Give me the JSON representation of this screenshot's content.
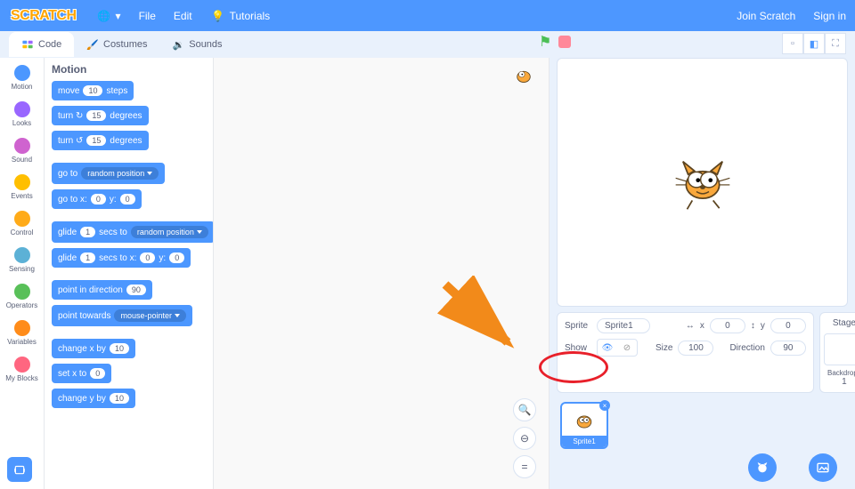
{
  "menubar": {
    "logo": "SCRATCH",
    "globe": "🌐",
    "file": "File",
    "edit": "Edit",
    "tutorials": "Tutorials",
    "join": "Join Scratch",
    "signin": "Sign in"
  },
  "tabs": {
    "code": "Code",
    "costumes": "Costumes",
    "sounds": "Sounds"
  },
  "categories": [
    {
      "name": "Motion",
      "color": "#4c97ff"
    },
    {
      "name": "Looks",
      "color": "#9966ff"
    },
    {
      "name": "Sound",
      "color": "#cf63cf"
    },
    {
      "name": "Events",
      "color": "#ffbf00"
    },
    {
      "name": "Control",
      "color": "#ffab19"
    },
    {
      "name": "Sensing",
      "color": "#5cb1d6"
    },
    {
      "name": "Operators",
      "color": "#59c059"
    },
    {
      "name": "Variables",
      "color": "#ff8c1a"
    },
    {
      "name": "My Blocks",
      "color": "#ff6680"
    }
  ],
  "palette": {
    "header": "Motion",
    "move_label_a": "move",
    "move_steps": "10",
    "move_label_b": "steps",
    "turn_cw_a": "turn ↻",
    "turn_cw_deg": "15",
    "turn_cw_b": "degrees",
    "turn_ccw_a": "turn ↺",
    "turn_ccw_deg": "15",
    "turn_ccw_b": "degrees",
    "goto_a": "go to",
    "goto_dd": "random position",
    "gotoxy_a": "go to x:",
    "gotoxy_x": "0",
    "gotoxy_b": "y:",
    "gotoxy_y": "0",
    "glide_a": "glide",
    "glide_secs": "1",
    "glide_b": "secs to",
    "glide_dd": "random position",
    "glidexy_a": "glide",
    "glidexy_secs": "1",
    "glidexy_b": "secs to x:",
    "glidexy_x": "0",
    "glidexy_c": "y:",
    "glidexy_y": "0",
    "point_dir_a": "point in direction",
    "point_dir_v": "90",
    "point_to_a": "point towards",
    "point_to_dd": "mouse-pointer",
    "chx_a": "change x by",
    "chx_v": "10",
    "setx_a": "set x to",
    "setx_v": "0",
    "chy_a": "change y by",
    "chy_v": "10"
  },
  "sprite_info": {
    "sprite_label": "Sprite",
    "sprite_name": "Sprite1",
    "x_icon": "↔",
    "x_label": "x",
    "x_val": "0",
    "y_icon": "↕",
    "y_label": "y",
    "y_val": "0",
    "show_label": "Show",
    "size_label": "Size",
    "size_val": "100",
    "dir_label": "Direction",
    "dir_val": "90"
  },
  "stage_col": {
    "stage_label": "Stage",
    "backdrops_label": "Backdrops",
    "backdrops_count": "1"
  },
  "sprite_tile": {
    "name": "Sprite1"
  },
  "colors": {
    "brand": "#4d97ff",
    "motion": "#4c97ff"
  }
}
